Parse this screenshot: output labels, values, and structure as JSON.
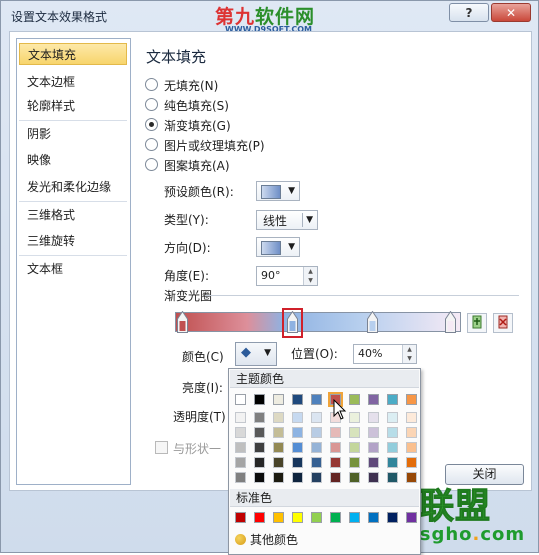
{
  "window": {
    "title": "设置文本效果格式",
    "help_label": "?",
    "close_label": "✕"
  },
  "watermark_top": {
    "part1": "第九",
    "part2": "软件网",
    "url": "WWW.D9SOFT.COM"
  },
  "watermark_bottom": {
    "text": "技术员联盟",
    "url_main": "www.jsgho",
    "url_dot": ".",
    "url_end": "com"
  },
  "nav": {
    "items": [
      "文本填充",
      "文本边框",
      "轮廓样式",
      "阴影",
      "映像",
      "发光和柔化边缘",
      "三维格式",
      "三维旋转",
      "文本框"
    ],
    "selected": 0
  },
  "panel": {
    "heading": "文本填充",
    "fill_options": [
      "无填充(N)",
      "纯色填充(S)",
      "渐变填充(G)",
      "图片或纹理填充(P)",
      "图案填充(A)"
    ],
    "selected_option": 2,
    "preset_label": "预设颜色(R):",
    "type_label": "类型(Y):",
    "type_value": "线性",
    "direction_label": "方向(D):",
    "angle_label": "角度(E):",
    "angle_value": "90°",
    "gradient_stops_label": "渐变光圈",
    "color_label": "颜色(C)",
    "position_label": "位置(O):",
    "position_value": "40%",
    "brightness_label": "亮度(I):",
    "transparency_label": "透明度(T)",
    "rotate_checkbox_label": "与形状一",
    "close_button": "关闭"
  },
  "color_picker": {
    "theme_label": "主题颜色",
    "standard_label": "标准色",
    "more_colors_label": "其他颜色",
    "theme_colors": [
      "#ffffff",
      "#000000",
      "#eeece1",
      "#1f497d",
      "#4f81bd",
      "#c0504d",
      "#9bbb59",
      "#8064a2",
      "#4bacc6",
      "#f79646"
    ],
    "theme_shades": [
      [
        "#f2f2f2",
        "#7f7f7f",
        "#ddd9c3",
        "#c6d9f0",
        "#dbe5f1",
        "#f2dcdb",
        "#ebf1dd",
        "#e5e0ec",
        "#dbeef3",
        "#fdeada"
      ],
      [
        "#d8d8d8",
        "#595959",
        "#c4bd97",
        "#8db3e2",
        "#b8cce4",
        "#e5b9b7",
        "#d7e3bc",
        "#ccc1d9",
        "#b7dde8",
        "#fbd5b5"
      ],
      [
        "#bfbfbf",
        "#3f3f3f",
        "#938953",
        "#548dd4",
        "#95b3d7",
        "#d99694",
        "#c3d69b",
        "#b2a2c7",
        "#92cddc",
        "#fac08f"
      ],
      [
        "#a5a5a5",
        "#262626",
        "#494429",
        "#17365d",
        "#366092",
        "#953734",
        "#76923c",
        "#5f497a",
        "#31859b",
        "#e36c09"
      ],
      [
        "#7f7f7f",
        "#0c0c0c",
        "#1d1b10",
        "#0f243e",
        "#244061",
        "#632423",
        "#4f6128",
        "#3f3151",
        "#205867",
        "#974806"
      ]
    ],
    "standard_colors": [
      "#c00000",
      "#ff0000",
      "#ffc000",
      "#ffff00",
      "#92d050",
      "#00b050",
      "#00b0f0",
      "#0070c0",
      "#002060",
      "#7030a0"
    ],
    "selected_theme_index": 5
  }
}
